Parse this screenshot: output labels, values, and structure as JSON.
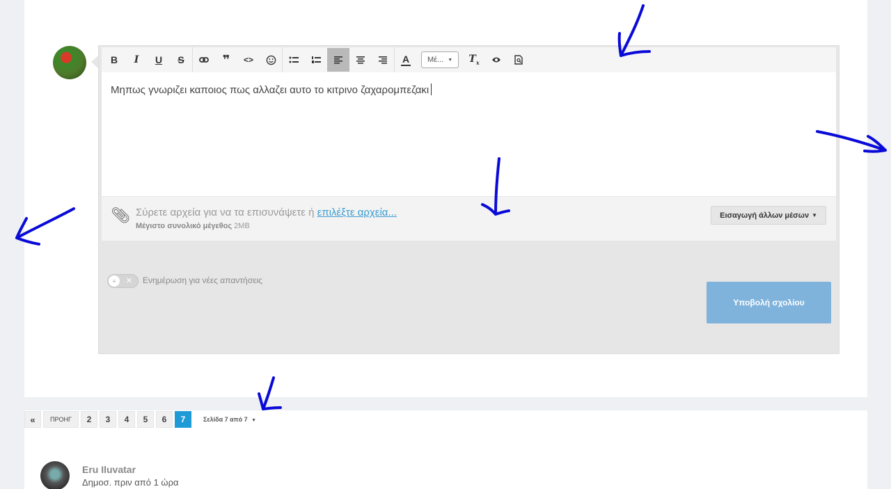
{
  "toolbar": {
    "bold": "B",
    "italic": "I",
    "underline": "U",
    "strike": "S",
    "quote": "❞",
    "code": "<>",
    "font_size_value": "Μέ...",
    "font_color": "A"
  },
  "editor": {
    "text": "Μηπως γνωριζει καποιος πως αλλαζει αυτο το κιτρινο ζαχαρομπεζακι"
  },
  "attachments": {
    "drop_text": "Σύρετε αρχεία για να τα επισυνάψετε ή ",
    "choose_link": "επιλέξτε αρχεία...",
    "max_label": "Μέγιστο συνολικό μέγεθος",
    "max_value": "2MB",
    "media_button": "Εισαγωγή άλλων μέσων"
  },
  "notify": {
    "label": "Ενημέρωση για νέες απαντήσεις"
  },
  "submit": {
    "label": "Υποβολή σχολίου"
  },
  "pagination": {
    "first": "«",
    "prev": "ΠΡΟΗΓ",
    "pages": [
      "2",
      "3",
      "4",
      "5",
      "6",
      "7"
    ],
    "current": "7",
    "page_label": "Σελίδα 7 από 7"
  },
  "next_comment": {
    "author": "Eru Iluvatar",
    "time": "Δημοσ. πριν από 1 ώρα"
  },
  "colors": {
    "accent": "#1e9ad7",
    "submit_bg": "#7fb3dc",
    "annotation_ink": "#0a0ad8"
  }
}
